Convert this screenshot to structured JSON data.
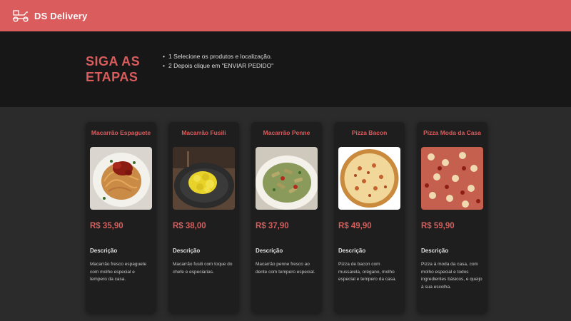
{
  "navbar": {
    "brand": "DS Delivery",
    "logo_icon": "delivery-scooter-icon",
    "background": "#da5c5c"
  },
  "steps": {
    "title": "SIGA AS ETAPAS",
    "items": [
      "1 Selecione os produtos e localização.",
      "2 Depois clique em \"ENVIAR PEDIDO\""
    ]
  },
  "accent_color": "#da5c5c",
  "products": [
    {
      "name": "Macarrão Espaguete",
      "price": "R$ 35,90",
      "description_label": "Descrição",
      "description": "Macarrão fresco espaguete com molho especial e tempero da casa.",
      "image_icon": "spaghetti-photo"
    },
    {
      "name": "Macarrão Fusili",
      "price": "R$ 38,00",
      "description_label": "Descrição",
      "description": "Macarrão fusili com toque do chefe e especiarias.",
      "image_icon": "fusilli-photo"
    },
    {
      "name": "Macarrão Penne",
      "price": "R$ 37,90",
      "description_label": "Descrição",
      "description": "Macarrão penne fresco ao dente com tempero especial.",
      "image_icon": "penne-photo"
    },
    {
      "name": "Pizza Bacon",
      "price": "R$ 49,90",
      "description_label": "Descrição",
      "description": "Pizza de bacon com mussarela, orégano, molho especial e tempero da casa.",
      "image_icon": "bacon-pizza-photo"
    },
    {
      "name": "Pizza Moda da Casa",
      "price": "R$ 59,90",
      "description_label": "Descrição",
      "description": "Pizza à moda da casa, com molho especial e todos ingredientes básicos, e queijo à sua escolha.",
      "image_icon": "house-pizza-photo"
    }
  ]
}
